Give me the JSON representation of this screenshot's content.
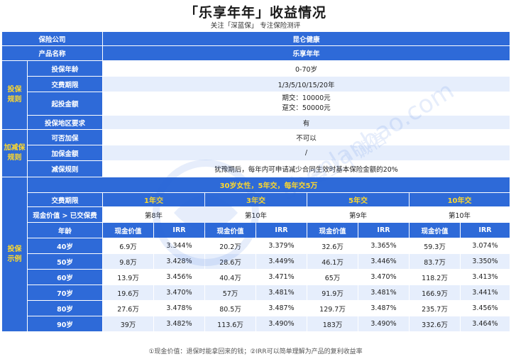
{
  "header": {
    "title": "「乐享年年」收益情况",
    "subtitle": "关注「深蓝保」 专注保险测评"
  },
  "basic": {
    "company_label": "保险公司",
    "company_value": "昆仑健康",
    "product_label": "产品名称",
    "product_value": "乐享年年"
  },
  "rules": {
    "group_label": "投保规则",
    "items": [
      {
        "label": "投保年龄",
        "value": "0-70岁"
      },
      {
        "label": "交费期限",
        "value": "1/3/5/10/15/20年"
      },
      {
        "label": "起投金额",
        "value_line1": "期交：10000元",
        "value_line2": "趸交：50000元"
      },
      {
        "label": "投保地区要求",
        "value": "有"
      }
    ]
  },
  "addreduce": {
    "group_label": "加减保规则",
    "items": [
      {
        "label": "可否加保",
        "value": "不可以"
      },
      {
        "label": "加保金额",
        "value": "/"
      },
      {
        "label": "减保规则",
        "value": "犹豫期后，每年内可申请减少合同生效时基本保险金额的20%"
      }
    ]
  },
  "example": {
    "group_label": "投保示例",
    "banner": "30岁女性，5年交，每年交5万",
    "period_label": "交费期限",
    "periods": [
      "1年交",
      "3年交",
      "5年交",
      "10年交"
    ],
    "breakeven_label": "现金价值 > 已交保费",
    "breakeven": [
      "第8年",
      "第10年",
      "第9年",
      "第10年"
    ],
    "age_label": "年龄",
    "cash_label": "现金价值",
    "irr_label": "IRR",
    "rows": [
      {
        "age": "40岁",
        "cells": [
          "6.9万",
          "3.344%",
          "20.2万",
          "3.379%",
          "32.6万",
          "3.365%",
          "59.3万",
          "3.074%"
        ]
      },
      {
        "age": "50岁",
        "cells": [
          "9.8万",
          "3.428%",
          "28.6万",
          "3.449%",
          "46.1万",
          "3.446%",
          "83.7万",
          "3.350%"
        ]
      },
      {
        "age": "60岁",
        "cells": [
          "13.9万",
          "3.456%",
          "40.4万",
          "3.471%",
          "65万",
          "3.470%",
          "118.2万",
          "3.413%"
        ]
      },
      {
        "age": "70岁",
        "cells": [
          "19.6万",
          "3.470%",
          "57万",
          "3.481%",
          "91.9万",
          "3.481%",
          "166.9万",
          "3.441%"
        ]
      },
      {
        "age": "80岁",
        "cells": [
          "27.6万",
          "3.478%",
          "80.5万",
          "3.487%",
          "129.7万",
          "3.487%",
          "235.7万",
          "3.456%"
        ]
      },
      {
        "age": "90岁",
        "cells": [
          "39万",
          "3.482%",
          "113.6万",
          "3.490%",
          "183万",
          "3.490%",
          "332.6万",
          "3.464%"
        ]
      }
    ]
  },
  "footnote": "①现金价值：退保时能拿回来的钱；②IRR可以简单理解为产品的复利收益率",
  "watermark": {
    "url_text": "shenlanbao.com",
    "slogan": "专业 | 诚信"
  }
}
